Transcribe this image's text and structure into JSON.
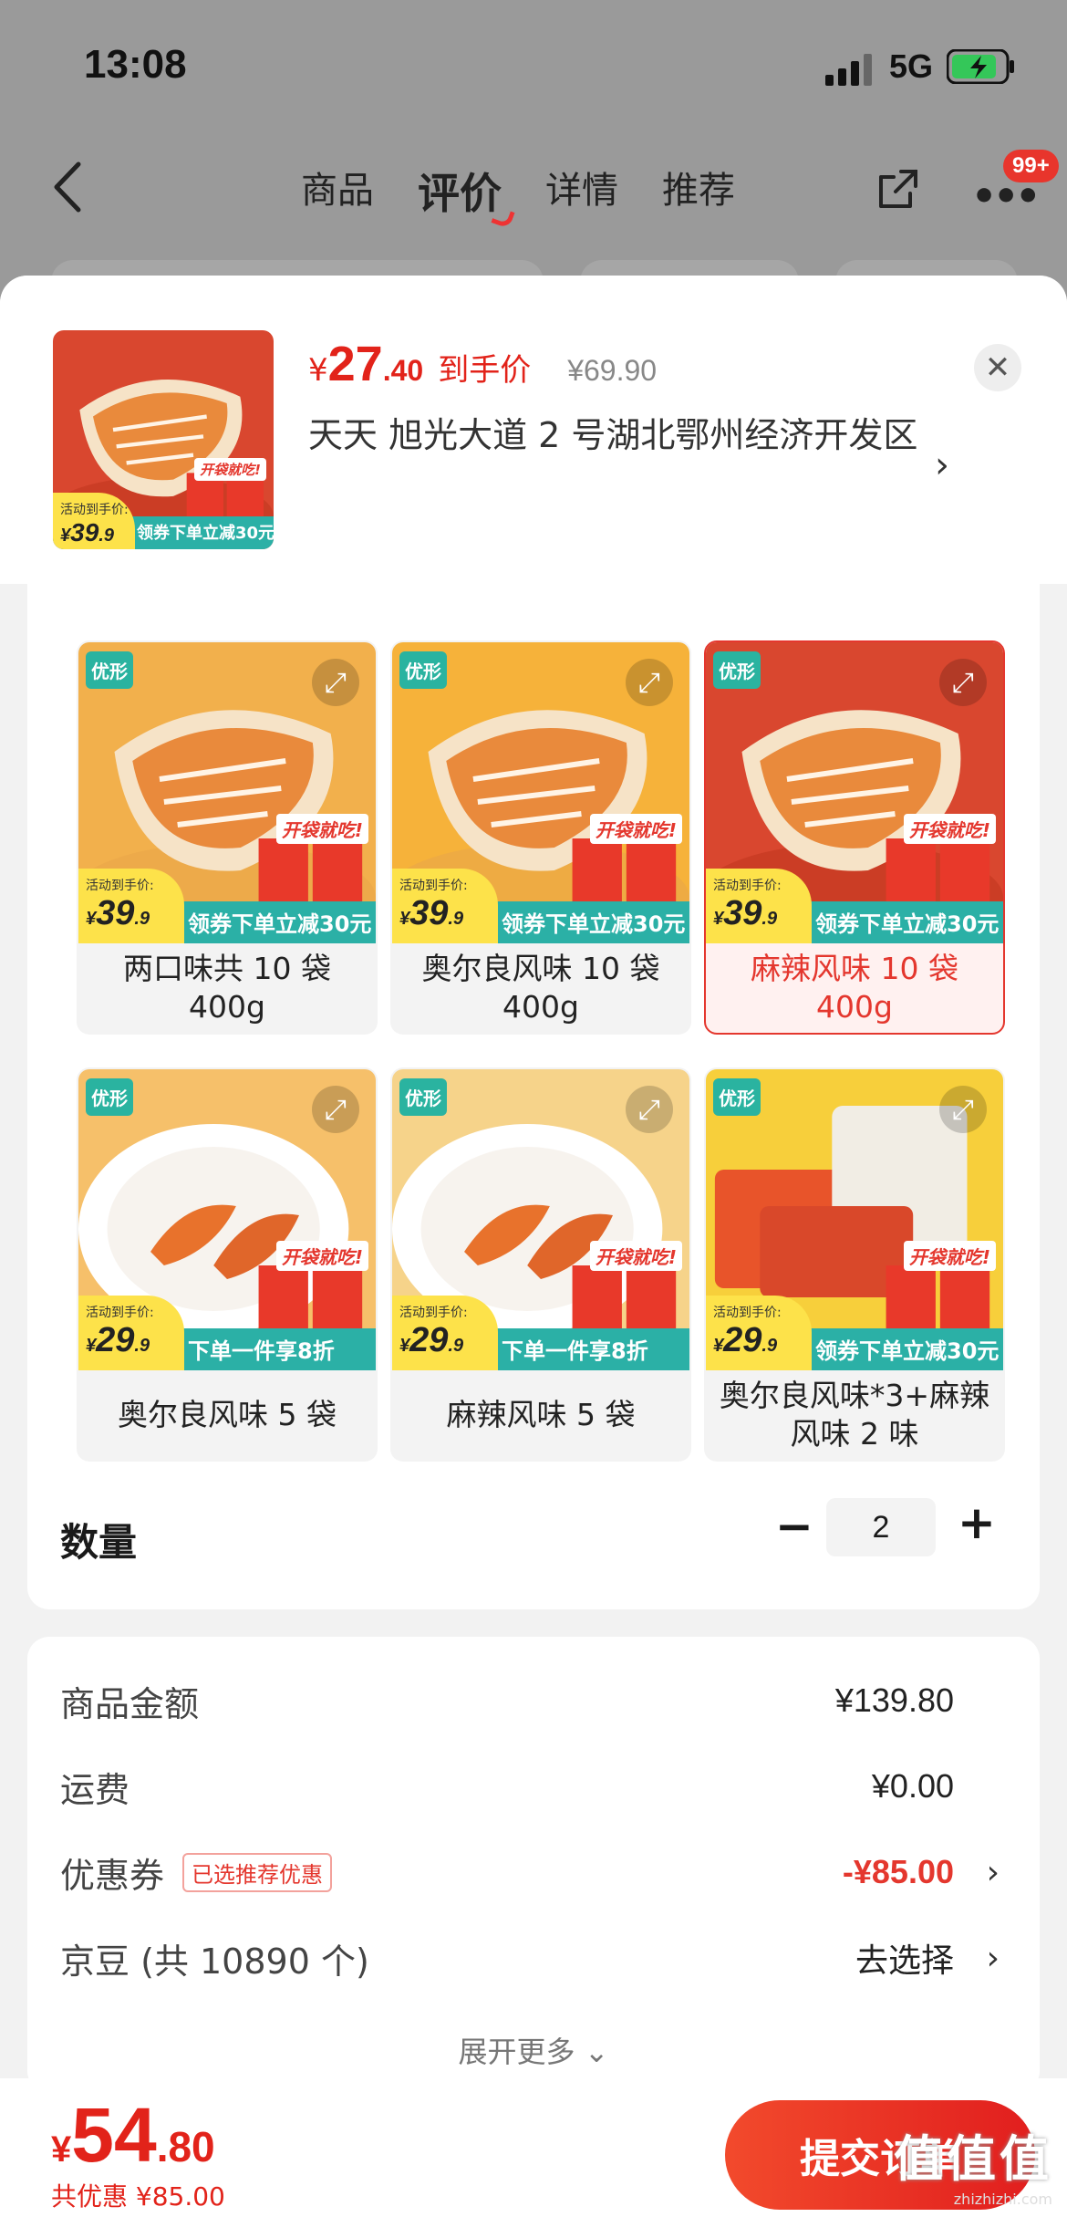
{
  "status": {
    "time": "13:08",
    "network": "5G"
  },
  "nav": {
    "tabs": [
      "商品",
      "评价",
      "详情",
      "推荐"
    ],
    "active_tab": 1,
    "badge": "99+"
  },
  "product": {
    "price_currency": "¥",
    "price_int": "27",
    "price_dec": ".40",
    "price_label": "到手价",
    "original_price": "¥69.90",
    "address": "天天  旭光大道 2 号湖北鄂州经济开发区"
  },
  "specs": [
    {
      "label": "两口味共 10 袋 400g",
      "promo_label": "活动到手价:",
      "promo_price": "39",
      "promo_price_dec": ".9",
      "promo_text": "领券下单立减30元",
      "tag": "开袋就吃!",
      "selected": false,
      "bg": "#f2b04c"
    },
    {
      "label": "奥尔良风味 10 袋 400g",
      "promo_label": "活动到手价:",
      "promo_price": "39",
      "promo_price_dec": ".9",
      "promo_text": "领券下单立减30元",
      "tag": "开袋就吃!",
      "selected": false,
      "bg": "#f6b23a"
    },
    {
      "label": "麻辣风味 10 袋 400g",
      "promo_label": "活动到手价:",
      "promo_price": "39",
      "promo_price_dec": ".9",
      "promo_text": "领券下单立减30元",
      "tag": "开袋就吃!",
      "selected": true,
      "bg": "#d9472f"
    },
    {
      "label": "奥尔良风味 5 袋",
      "promo_label": "活动到手价:",
      "promo_price": "29",
      "promo_price_dec": ".9",
      "promo_text": "下单一件享8折",
      "tag": "开袋就吃!",
      "selected": false,
      "bg": "#f6c06a"
    },
    {
      "label": "麻辣风味 5 袋",
      "promo_label": "活动到手价:",
      "promo_price": "29",
      "promo_price_dec": ".9",
      "promo_text": "下单一件享8折",
      "tag": "开袋就吃!",
      "selected": false,
      "bg": "#f6d38a"
    },
    {
      "label": "奥尔良风味*3+麻辣风味 2 味",
      "promo_label": "活动到手价:",
      "promo_price": "29",
      "promo_price_dec": ".9",
      "promo_text": "领券下单立减30元",
      "tag": "开袋就吃!",
      "selected": false,
      "bg": "#f7cf3b"
    }
  ],
  "thumb": {
    "promo_label": "活动到手价:",
    "promo_price": "39",
    "promo_price_dec": ".9",
    "promo_text": "领券下单立减30元",
    "tag": "开袋就吃!"
  },
  "brand": "优形",
  "quantity": {
    "label": "数量",
    "value": "2",
    "minus": "−",
    "plus": "+"
  },
  "summary": {
    "goods_label": "商品金额",
    "goods_value": "¥139.80",
    "shipping_label": "运费",
    "shipping_value": "¥0.00",
    "coupon_label": "优惠券",
    "coupon_tag": "已选推荐优惠",
    "coupon_value": "-¥85.00",
    "beans_label": "京豆 (共 10890 个)",
    "beans_value": "去选择",
    "expand": "展开更多"
  },
  "bottom": {
    "currency": "¥",
    "total_int": "54",
    "total_dec": ".80",
    "saving": "共优惠 ¥85.00",
    "submit": "提交订单",
    "watermark": "值值值",
    "watermark_url": "zhizhizhi.com"
  },
  "colors": {
    "accent": "#e2231a",
    "teal": "#2bb0a6",
    "yellow": "#fde24a"
  }
}
